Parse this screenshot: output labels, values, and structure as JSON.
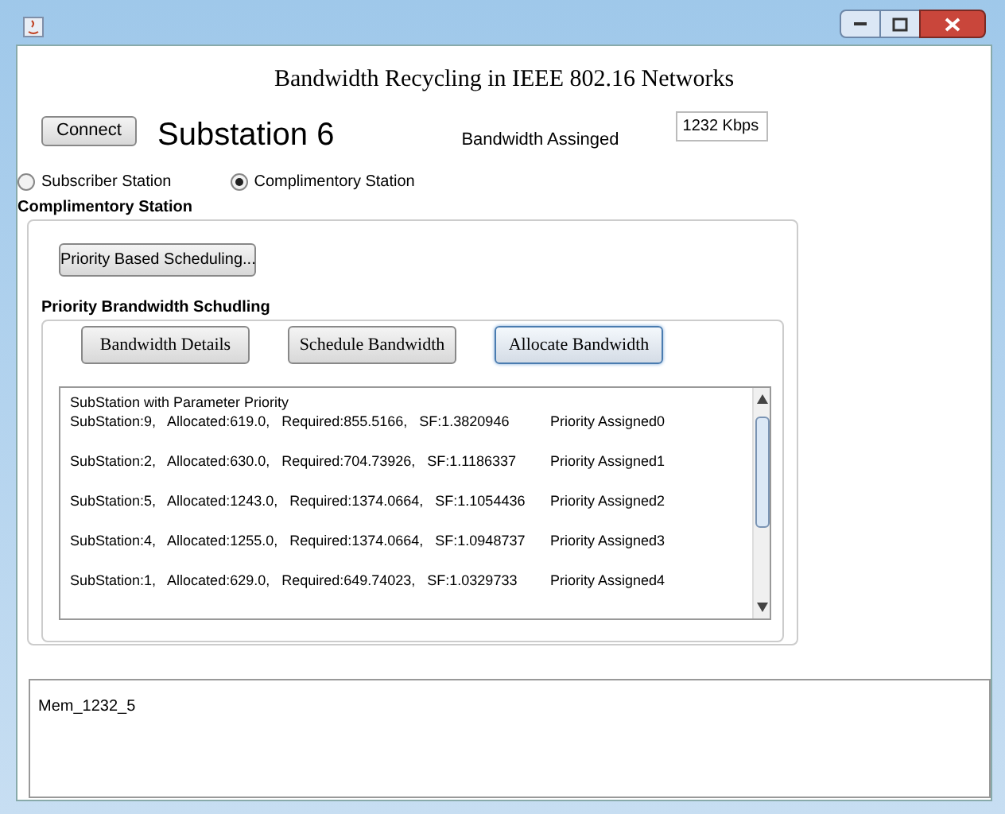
{
  "window": {
    "title": "Bandwidth Recycling in IEEE 802.16 Networks"
  },
  "connect_button": "Connect",
  "station_name": "Substation 6",
  "bandwidth_label": "Bandwidth Assinged",
  "bandwidth_value": "1232 Kbps",
  "station_types": [
    {
      "label": "Subscriber Station",
      "selected": false
    },
    {
      "label": "Complimentory Station",
      "selected": true
    }
  ],
  "panel": {
    "title": "Complimentory Station",
    "scheduling_button": "Priority Based Scheduling...",
    "inner_title": "Priority Brandwidth Schudling",
    "buttons": [
      {
        "label": "Bandwidth Details",
        "focused": false
      },
      {
        "label": "Schedule Bandwidth",
        "focused": false
      },
      {
        "label": "Allocate Bandwidth",
        "focused": true
      }
    ],
    "list": {
      "header": "SubStation with Parameter Priority",
      "rows": [
        {
          "params": "SubStation:9,   Allocated:619.0,   Required:855.5166,   SF:1.3820946",
          "priority": "Priority Assigned0"
        },
        {
          "params": "SubStation:2,   Allocated:630.0,   Required:704.73926,   SF:1.1186337",
          "priority": "Priority Assigned1"
        },
        {
          "params": "SubStation:5,   Allocated:1243.0,   Required:1374.0664,   SF:1.1054436",
          "priority": "Priority Assigned2"
        },
        {
          "params": "SubStation:4,   Allocated:1255.0,   Required:1374.0664,   SF:1.0948737",
          "priority": "Priority Assigned3"
        },
        {
          "params": "SubStation:1,   Allocated:629.0,   Required:649.74023,   SF:1.0329733",
          "priority": "Priority Assigned4"
        }
      ]
    }
  },
  "log": "Mem_1232_5"
}
